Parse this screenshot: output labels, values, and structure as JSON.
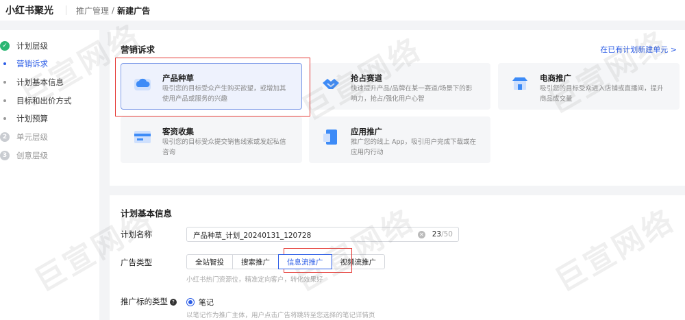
{
  "header": {
    "brand": "小红书聚光",
    "breadcrumb_parent": "推广管理",
    "breadcrumb_sep": "/",
    "breadcrumb_current": "新建广告"
  },
  "leftnav": {
    "steps": [
      {
        "label": "计划层级",
        "marker": "✓",
        "state": "done"
      },
      {
        "label": "营销诉求",
        "state": "active"
      },
      {
        "label": "计划基本信息",
        "state": "sub"
      },
      {
        "label": "目标和出价方式",
        "state": "sub"
      },
      {
        "label": "计划预算",
        "state": "sub"
      },
      {
        "label": "单元层级",
        "marker": "2",
        "state": "pending"
      },
      {
        "label": "创意层级",
        "marker": "3",
        "state": "pending"
      }
    ]
  },
  "marketing": {
    "title": "营销诉求",
    "create_unit_link": "在已有计划新建单元  >",
    "cards": [
      {
        "title": "产品种草",
        "desc1": "吸引您的目标受众产生购买欲望，或增加其",
        "desc2": "使用产品或服务的兴趣",
        "icon": "cloud-icon",
        "color": "#3d8bf7"
      },
      {
        "title": "抢占赛道",
        "desc1": "快速提升产品/品牌在某一赛道/场景下的影",
        "desc2": "响力，抢占/强化用户心智",
        "icon": "handshake-icon",
        "color": "#3d8bf7"
      },
      {
        "title": "电商推广",
        "desc1": "吸引您的目标受众进入店铺或直播间，提升",
        "desc2": "商品成交量",
        "icon": "shop-icon",
        "color": "#3d8bf7"
      },
      {
        "title": "客资收集",
        "desc1": "吸引您的目标受众提交销售线索或发起私信",
        "desc2": "咨询",
        "icon": "card-icon",
        "color": "#3d8bf7"
      },
      {
        "title": "应用推广",
        "desc1": "推广您的线上 App，吸引用户完成下载或在",
        "desc2": "应用内行动",
        "icon": "app-icon",
        "color": "#3d8bf7"
      }
    ]
  },
  "basic": {
    "title": "计划基本信息",
    "name_label": "计划名称",
    "name_value": "产品种草_计划_20240131_120728",
    "name_count": "23",
    "name_max": "/50",
    "type_label": "广告类型",
    "types": [
      "全站智投",
      "搜索推广",
      "信息流推广",
      "视频流推广"
    ],
    "type_selected": "信息流推广",
    "type_hint": "小红书热门资源位，精准定向客户，转化效果好",
    "target_label": "推广标的类型",
    "target_option": "笔记",
    "target_hint": "以笔记作为推广主体，用户点击广告将跳转至您选择的笔记详情页"
  },
  "watermark": "巨宣网络",
  "colors": {
    "accent": "#2b5ce6",
    "highlight": "#e53935",
    "done": "#2bb673"
  }
}
